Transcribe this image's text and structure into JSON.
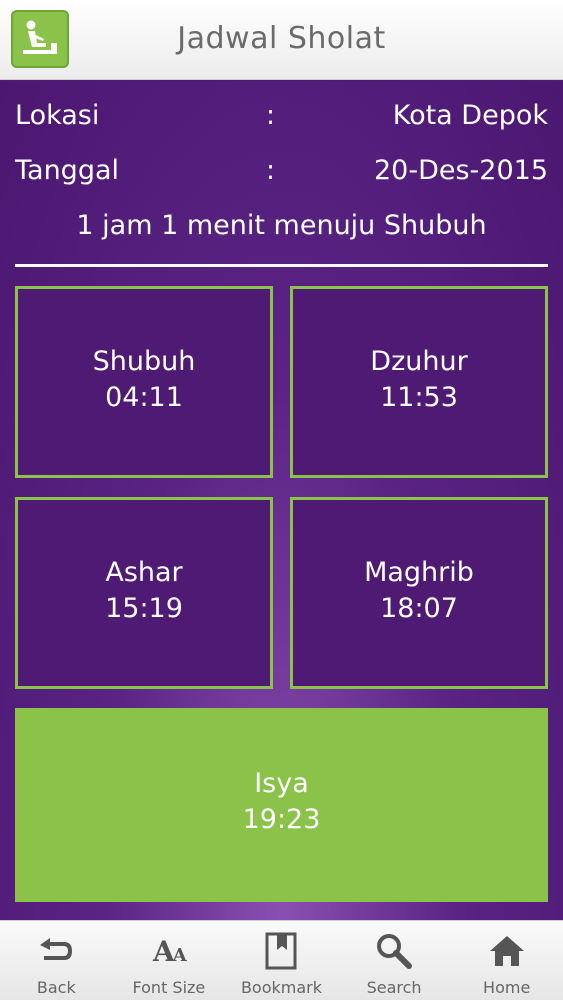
{
  "header": {
    "title": "Jadwal Sholat",
    "logo_icon": "praying-person-icon",
    "logo_color": "#8bc34a"
  },
  "info": {
    "location_label": "Lokasi",
    "location_value": "Kota Depok",
    "date_label": "Tanggal",
    "date_value": "20-Des-2015",
    "separator": ":",
    "countdown": "1 jam 1 menit menuju Shubuh"
  },
  "prayers": [
    {
      "name": "Shubuh",
      "time": "04:11"
    },
    {
      "name": "Dzuhur",
      "time": "11:53"
    },
    {
      "name": "Ashar",
      "time": "15:19"
    },
    {
      "name": "Maghrib",
      "time": "18:07"
    },
    {
      "name": "Isya",
      "time": "19:23",
      "highlighted": true
    }
  ],
  "colors": {
    "background": "#4e1a72",
    "accent": "#8bc34a"
  },
  "nav": [
    {
      "label": "Back",
      "icon": "back-arrow-icon"
    },
    {
      "label": "Font Size",
      "icon": "font-size-icon"
    },
    {
      "label": "Bookmark",
      "icon": "bookmark-icon"
    },
    {
      "label": "Search",
      "icon": "search-icon"
    },
    {
      "label": "Home",
      "icon": "home-icon"
    }
  ]
}
